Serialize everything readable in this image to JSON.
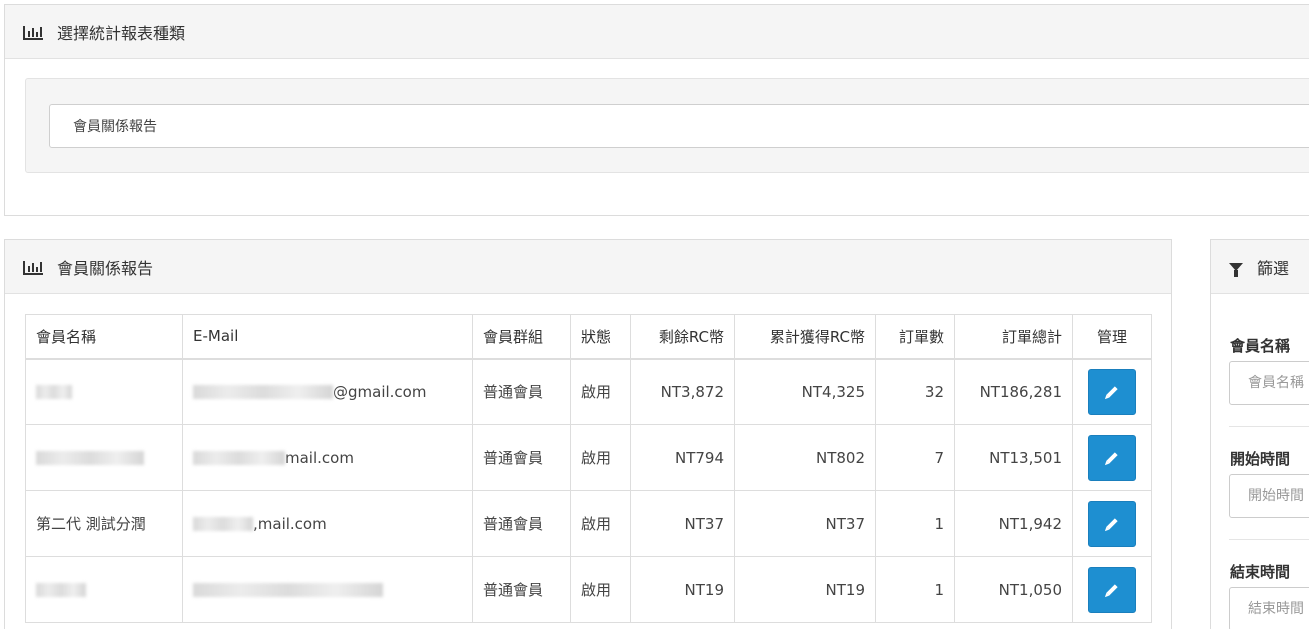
{
  "report_select": {
    "title": "選擇統計報表種類",
    "selected": "會員關係報告"
  },
  "report": {
    "title": "會員關係報告",
    "columns": [
      "會員名稱",
      "E-Mail",
      "會員群組",
      "狀態",
      "剩餘RC幣",
      "累計獲得RC幣",
      "訂單數",
      "訂單總計",
      "管理"
    ],
    "rows": [
      {
        "name": "",
        "email": "@gmail.com",
        "group": "普通會員",
        "status": "啟用",
        "rc_left": "NT3,872",
        "rc_total": "NT4,325",
        "orders": "32",
        "order_total": "NT186,281"
      },
      {
        "name": "",
        "email": "mail.com",
        "group": "普通會員",
        "status": "啟用",
        "rc_left": "NT794",
        "rc_total": "NT802",
        "orders": "7",
        "order_total": "NT13,501"
      },
      {
        "name": "第二代 測試分潤",
        "email": ",mail.com",
        "group": "普通會員",
        "status": "啟用",
        "rc_left": "NT37",
        "rc_total": "NT37",
        "orders": "1",
        "order_total": "NT1,942"
      },
      {
        "name": "",
        "email": "",
        "group": "普通會員",
        "status": "啟用",
        "rc_left": "NT19",
        "rc_total": "NT19",
        "orders": "1",
        "order_total": "NT1,050"
      }
    ]
  },
  "filter": {
    "title": "篩選",
    "member_name_label": "會員名稱",
    "member_name_placeholder": "會員名稱",
    "start_label": "開始時間",
    "start_placeholder": "開始時間",
    "end_label": "結束時間",
    "end_placeholder": "結束時間"
  },
  "colors": {
    "edit_button": "#1e8fd1",
    "panel_heading": "#f5f5f5"
  }
}
